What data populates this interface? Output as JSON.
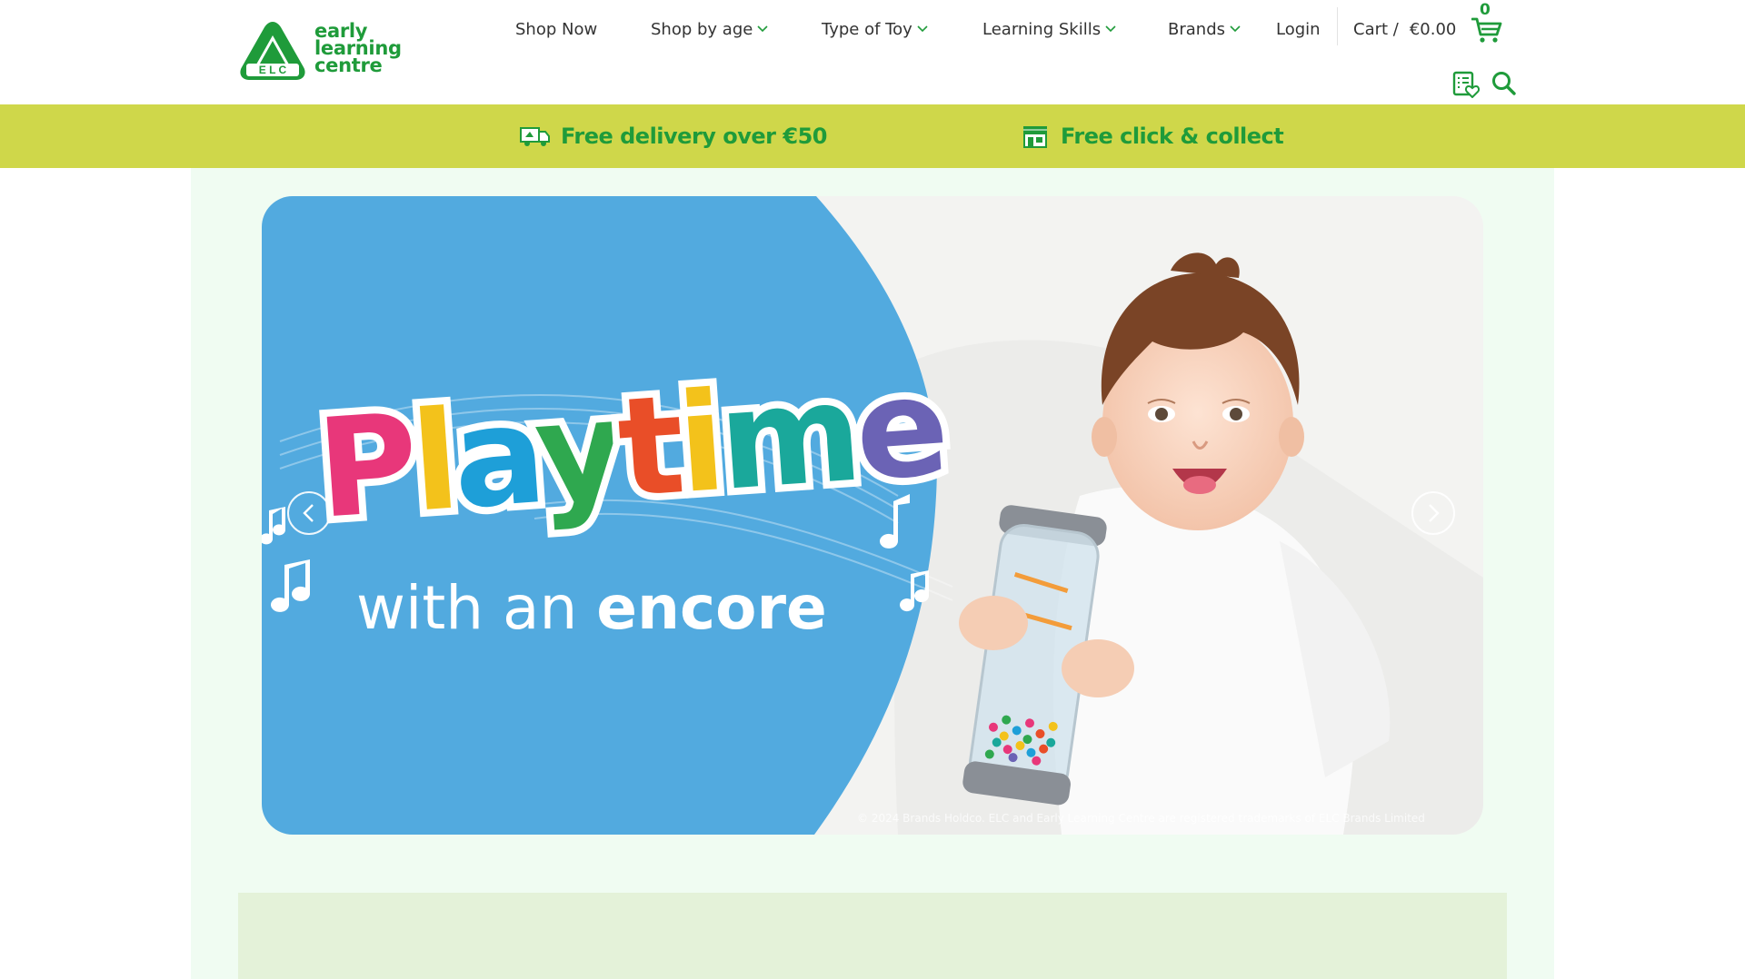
{
  "header": {
    "logo": {
      "name": "early learning centre logo",
      "lines": [
        "early",
        "learning",
        "centre"
      ],
      "badge": "ELC",
      "color": "#1f9b3a"
    },
    "nav": [
      {
        "label": "Shop Now",
        "dropdown": false
      },
      {
        "label": "Shop by age",
        "dropdown": true
      },
      {
        "label": "Type of Toy",
        "dropdown": true
      },
      {
        "label": "Learning Skills",
        "dropdown": true
      },
      {
        "label": "Brands",
        "dropdown": true
      }
    ],
    "login_label": "Login",
    "cart_label": "Cart /",
    "cart_total": "€0.00",
    "cart_count": "0",
    "icons": {
      "cart": "cart-icon",
      "wishlist": "wishlist-icon",
      "search": "search-icon"
    }
  },
  "promo_bar": {
    "background": "#cfd74a",
    "items": [
      {
        "icon": "delivery-van-icon",
        "text": "Free delivery over €50"
      },
      {
        "icon": "store-icon",
        "text": "Free click & collect"
      }
    ]
  },
  "hero": {
    "headline_letters": [
      {
        "char": "P",
        "color": "#e8377a"
      },
      {
        "char": "l",
        "color": "#f3c21b"
      },
      {
        "char": "a",
        "color": "#1e9fd8"
      },
      {
        "char": "y",
        "color": "#2fa84f"
      },
      {
        "char": "t",
        "color": "#e94e28"
      },
      {
        "char": "i",
        "color": "#f3c21b"
      },
      {
        "char": "m",
        "color": "#1aa89b"
      },
      {
        "char": "e",
        "color": "#6b63b5"
      }
    ],
    "subline_light": "with an ",
    "subline_bold": "encore",
    "legal_text": "© 2024 Brands Holdco. ELC and Early Learning Centre are registered trademarks of ELC Brands Limited",
    "carousel": {
      "prev_icon": "chevron-left-icon",
      "next_icon": "chevron-right-icon"
    }
  },
  "colors": {
    "brand_green": "#1f9b3a",
    "hero_blue": "#52aadf",
    "page_mint": "#f0fcf2",
    "lower_panel": "#e4f2d9"
  }
}
